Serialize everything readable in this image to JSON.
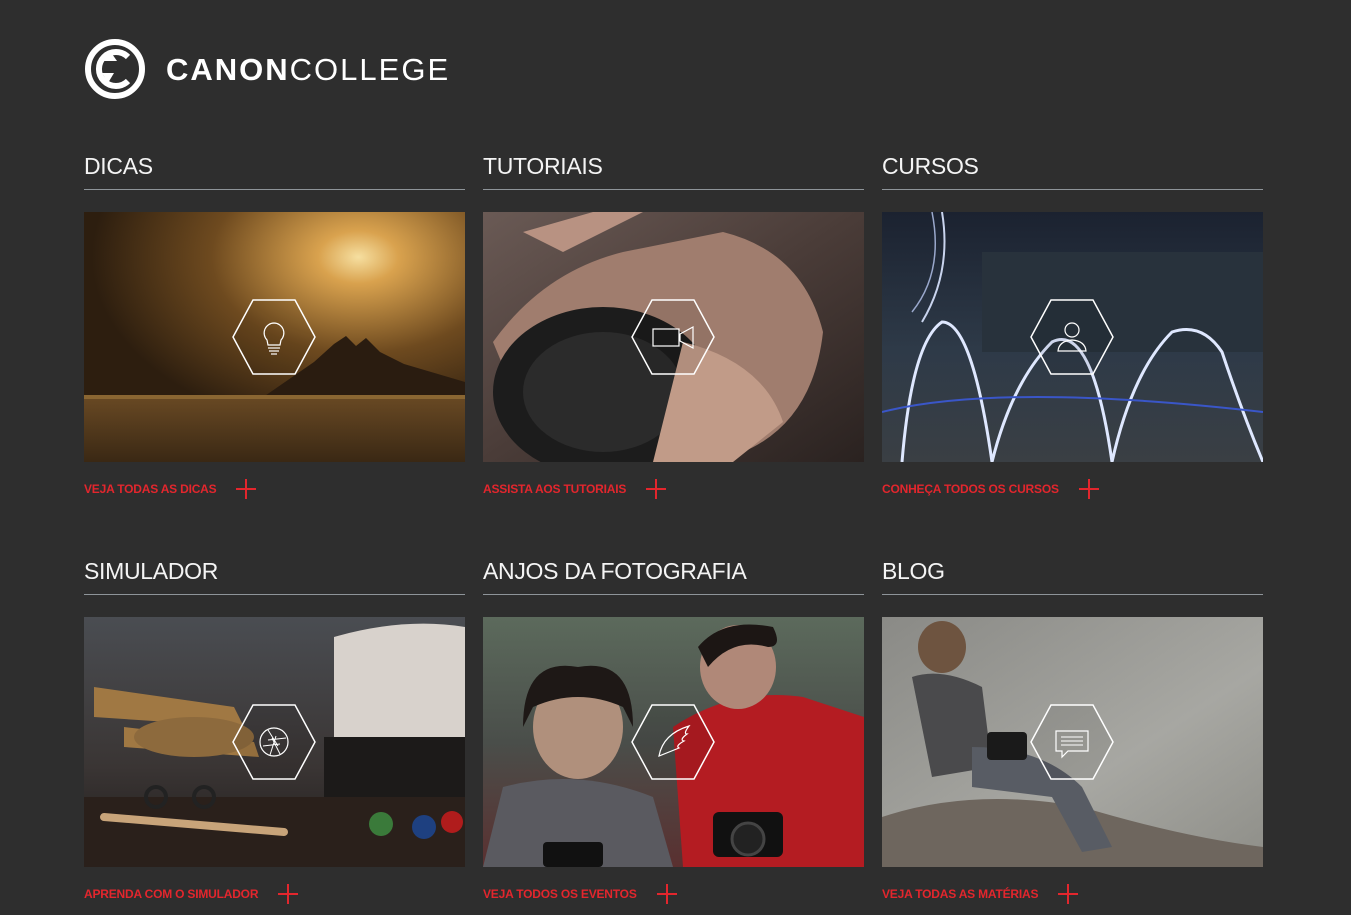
{
  "brand": {
    "name_bold": "CANON",
    "name_light": "COLLEGE"
  },
  "colors": {
    "background": "#2e2e2e",
    "accent": "#e3262d",
    "divider": "#8e9499"
  },
  "sections": [
    {
      "title": "DICAS",
      "cta": "VEJA TODAS AS DICAS",
      "icon": "lightbulb-icon"
    },
    {
      "title": "TUTORIAIS",
      "cta": "ASSISTA AOS TUTORIAIS",
      "icon": "video-camera-icon"
    },
    {
      "title": "CURSOS",
      "cta": "CONHEÇA TODOS OS CURSOS",
      "icon": "user-icon"
    },
    {
      "title": "SIMULADOR",
      "cta": "APRENDA COM O SIMULADOR",
      "icon": "aperture-icon"
    },
    {
      "title": "ANJOS DA FOTOGRAFIA",
      "cta": "VEJA TODOS OS EVENTOS",
      "icon": "wing-icon"
    },
    {
      "title": "BLOG",
      "cta": "VEJA TODAS AS MATÉRIAS",
      "icon": "chat-bubble-icon"
    }
  ]
}
